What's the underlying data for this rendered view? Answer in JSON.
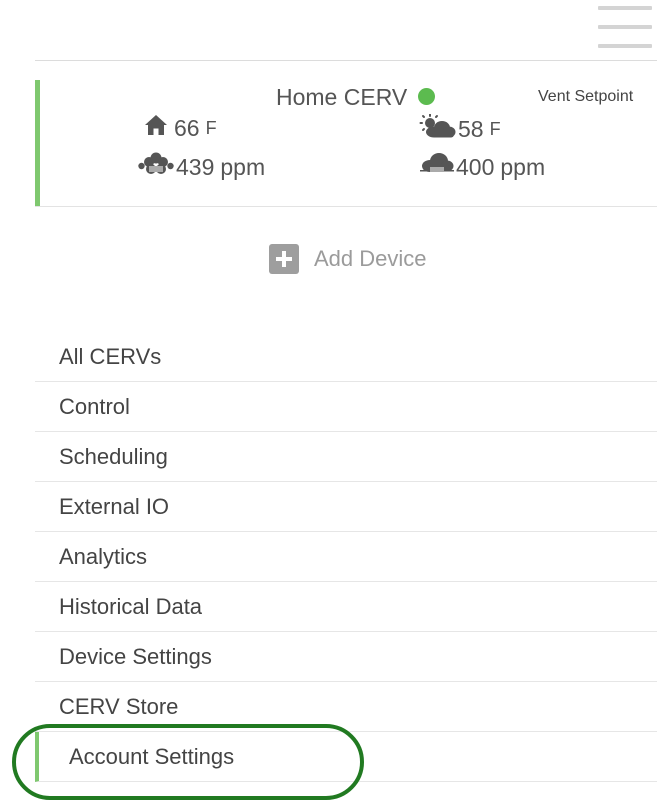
{
  "header": {
    "menu_icon": "hamburger-menu-icon"
  },
  "device_card": {
    "name": "Home CERV",
    "status_color": "#5cbb4f",
    "status_label": "online",
    "vent_setpoint_label": "Vent Setpoint",
    "indoor_temperature": {
      "icon": "home-icon",
      "value": "66",
      "unit": "F"
    },
    "outdoor_temperature": {
      "icon": "partly-cloudy-icon",
      "value": "58",
      "unit": "F"
    },
    "indoor_air": {
      "icon": "indoor-voc-molecule-icon",
      "value": "439",
      "unit": "ppm"
    },
    "outdoor_air": {
      "icon": "outdoor-voc-cloud-icon",
      "value": "400",
      "unit": "ppm"
    }
  },
  "add_device": {
    "icon": "plus-box-icon",
    "label": "Add Device"
  },
  "nav": {
    "items": [
      {
        "label": "All CERVs"
      },
      {
        "label": "Control"
      },
      {
        "label": "Scheduling"
      },
      {
        "label": "External IO"
      },
      {
        "label": "Analytics"
      },
      {
        "label": "Historical Data"
      },
      {
        "label": "Device Settings"
      },
      {
        "label": "CERV Store"
      },
      {
        "label": "Account Settings",
        "active": true
      }
    ]
  },
  "colors": {
    "accent": "#7fc86f",
    "highlight": "#217a21",
    "text": "#444444",
    "muted": "#9b9b9b"
  }
}
